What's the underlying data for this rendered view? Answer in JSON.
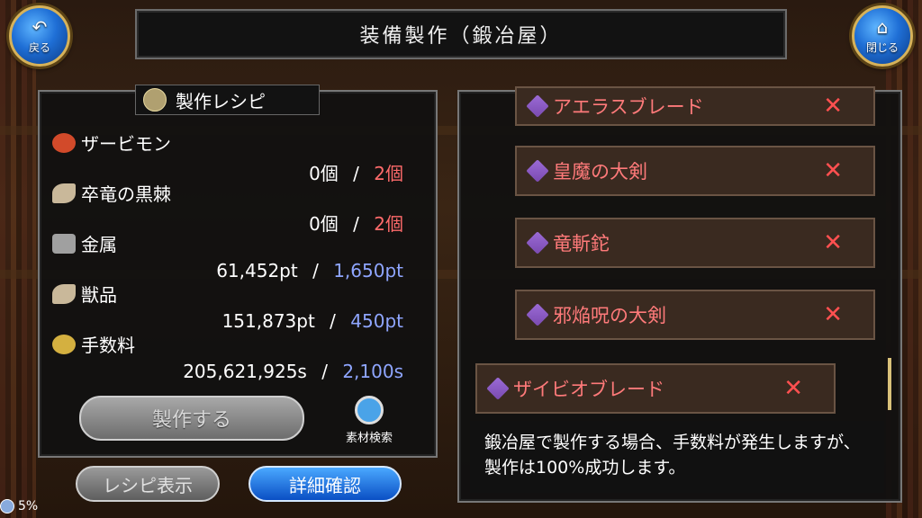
{
  "header": {
    "title": "装備製作（鍛冶屋）",
    "back_label": "戻る",
    "close_label": "閉じる"
  },
  "recipe": {
    "title": "製作レシピ",
    "materials": [
      {
        "name": "ザービモン",
        "have": "0個",
        "sep": "/",
        "need": "2個"
      },
      {
        "name": "卒竜の黒棘",
        "have": "0個",
        "sep": "/",
        "need": "2個"
      },
      {
        "name": "金属",
        "have": "61,452pt",
        "sep": "/",
        "need": "1,650pt"
      },
      {
        "name": "獣品",
        "have": "151,873pt",
        "sep": "/",
        "need": "450pt"
      },
      {
        "name": "手数料",
        "have": "205,621,925s",
        "sep": "/",
        "need": "2,100s"
      }
    ],
    "make_label": "製作する",
    "search_label": "素材検索",
    "recipe_display_label": "レシピ表示",
    "details_label": "詳細確認"
  },
  "items": [
    {
      "name": "アエラスブレード",
      "mark": "✕"
    },
    {
      "name": "皇魔の大剣",
      "mark": "✕"
    },
    {
      "name": "竜斬鉈",
      "mark": "✕"
    },
    {
      "name": "邪焔呪の大剣",
      "mark": "✕"
    },
    {
      "name": "ザイビオブレード",
      "mark": "✕"
    }
  ],
  "message": "鍛冶屋で製作する場合、手数料が発生しますが、製作は100%成功します。",
  "status": {
    "percent": "5%"
  },
  "colors": {
    "need_red": "#ff6b6b",
    "need_blue": "#8fa6ff",
    "item_text": "#ff7a7a"
  }
}
